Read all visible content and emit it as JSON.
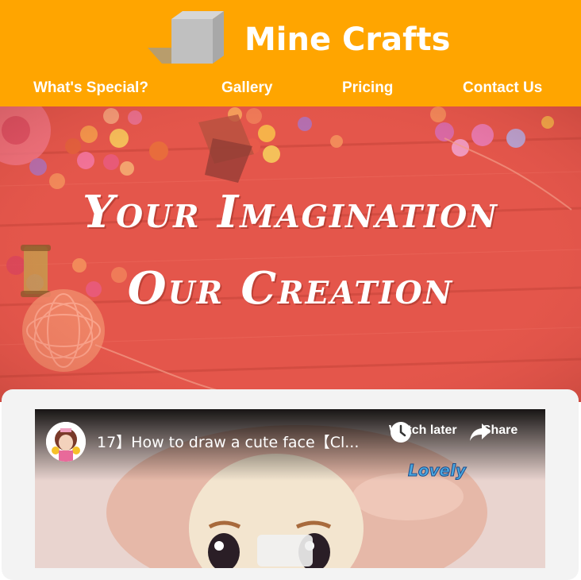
{
  "header": {
    "brand": "Mine Crafts",
    "logo_icon": "cube-icon",
    "nav": [
      "What's Special?",
      "Gallery",
      "Pricing",
      "Contact Us"
    ]
  },
  "hero": {
    "line1": "Your Imagination",
    "line2": "Our Creation"
  },
  "video": {
    "title": "17】How to draw a cute face【Cl...",
    "watch_later": "Watch later",
    "share": "Share",
    "clock_icon": "clock-icon",
    "share_icon": "share-icon"
  },
  "colors": {
    "header_bg": "#ffa500",
    "hero_overlay": "#e4564b",
    "panel_bg": "#f3f3f3"
  }
}
